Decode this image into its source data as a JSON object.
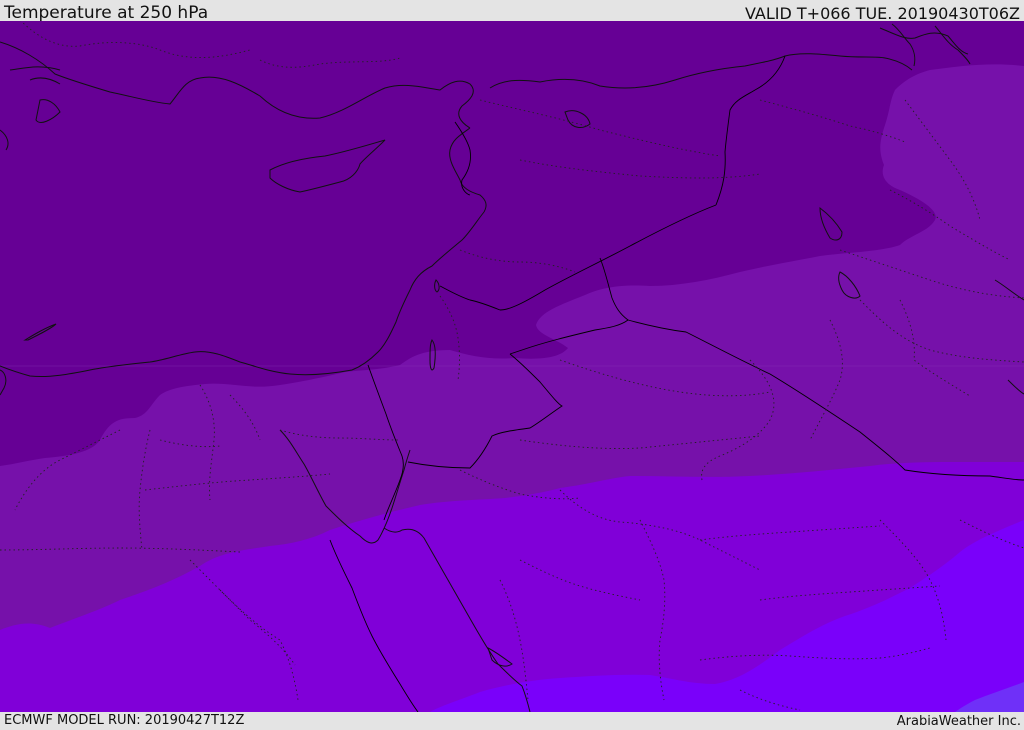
{
  "header": {
    "title": "Temperature at 250 hPa",
    "valid_time": "VALID T+066 TUE. 20190430T06Z"
  },
  "footer": {
    "model_run": "ECMWF MODEL RUN: 20190427T12Z",
    "credit": "ArabiaWeather Inc."
  },
  "map": {
    "field": "temperature",
    "level": "250 hPa",
    "color_bands": [
      "#660095",
      "#7611aa",
      "#8000d8",
      "#7a00fa",
      "#6f30f8"
    ],
    "overlays": [
      "coastlines",
      "country-borders",
      "admin-borders"
    ]
  }
}
